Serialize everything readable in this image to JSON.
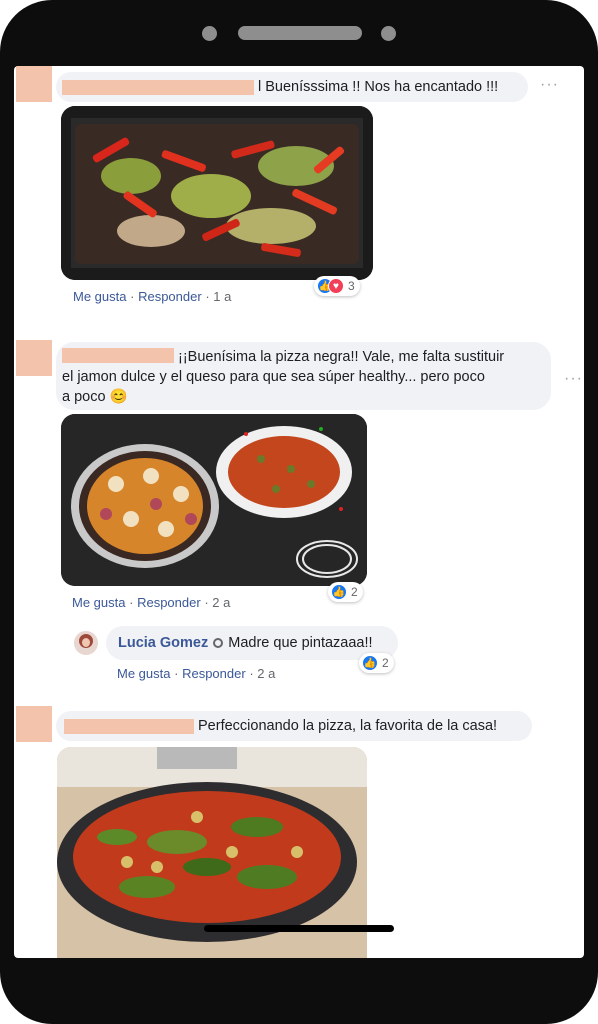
{
  "comments": [
    {
      "text": "l Buenísssima !! Nos ha encantado !!!",
      "actions": {
        "like": "Me gusta",
        "reply": "Responder",
        "time": "1 a"
      },
      "reactions": {
        "count": "3",
        "icons": [
          "like-icon",
          "love-icon"
        ]
      }
    },
    {
      "text_line1": "¡¡Buenísima la pizza negra!! Vale, me falta sustituir",
      "text_line2": "el jamon dulce y el queso para que sea súper healthy... pero poco",
      "text_line3": "a poco",
      "emoji": "😊",
      "actions": {
        "like": "Me gusta",
        "reply": "Responder",
        "time": "2 a"
      },
      "reactions": {
        "count": "2",
        "icons": [
          "like-icon"
        ]
      }
    },
    {
      "author": "Lucia Gomez",
      "text": "Madre que pintazaaa!!",
      "actions": {
        "like": "Me gusta",
        "reply": "Responder",
        "time": "2 a"
      },
      "reactions": {
        "count": "2",
        "icons": [
          "like-icon"
        ]
      }
    },
    {
      "text": "Perfeccionando la pizza, la favorita de la casa!"
    }
  ],
  "separator": "·",
  "more_glyph": "···",
  "colors": {
    "link": "#3b5998",
    "bubble": "#f0f2f5",
    "redaction": "#f4c3ab",
    "like": "#1877f2",
    "love": "#f33e58"
  }
}
